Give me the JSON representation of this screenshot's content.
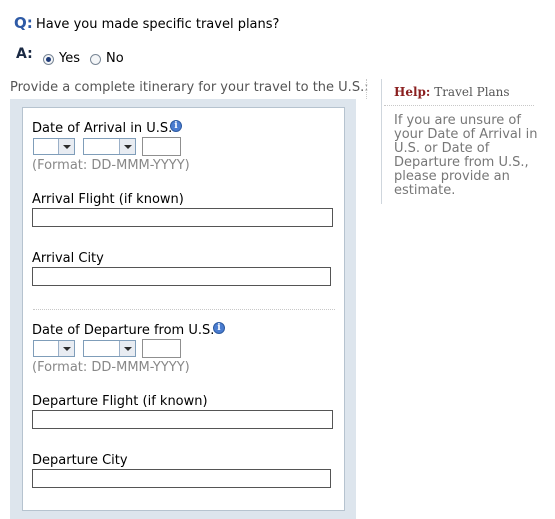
{
  "question": {
    "marker": "Q:",
    "text": "Have you made specific travel plans?"
  },
  "answer": {
    "marker": "A:",
    "options": [
      {
        "label": "Yes",
        "selected": true
      },
      {
        "label": "No",
        "selected": false
      }
    ]
  },
  "instruction": "Provide a complete itinerary for your travel to the U.S.:",
  "form": {
    "arrival_date": {
      "label": "Date of Arrival in U.S.",
      "day_value": "",
      "month_value": "",
      "year_value": "",
      "format_hint": "(Format: DD-MMM-YYYY)"
    },
    "arrival_flight": {
      "label": "Arrival Flight (if known)",
      "value": ""
    },
    "arrival_city": {
      "label": "Arrival City",
      "value": ""
    },
    "departure_date": {
      "label": "Date of Departure from U.S.",
      "day_value": "",
      "month_value": "",
      "year_value": "",
      "format_hint": "(Format: DD-MMM-YYYY)"
    },
    "departure_flight": {
      "label": "Departure Flight (if known)",
      "value": ""
    },
    "departure_city": {
      "label": "Departure City",
      "value": ""
    }
  },
  "help": {
    "heading_prefix": "Help:",
    "heading": "Travel Plans",
    "text": "If you are unsure of your Date of Arrival in U.S. or Date of Departure from U.S., please provide an estimate."
  },
  "colors": {
    "accent": "#2e5aa6",
    "help_heading": "#8a1f1f",
    "panel_bg": "#dde5ed"
  },
  "icons": {
    "info": "info-icon"
  }
}
